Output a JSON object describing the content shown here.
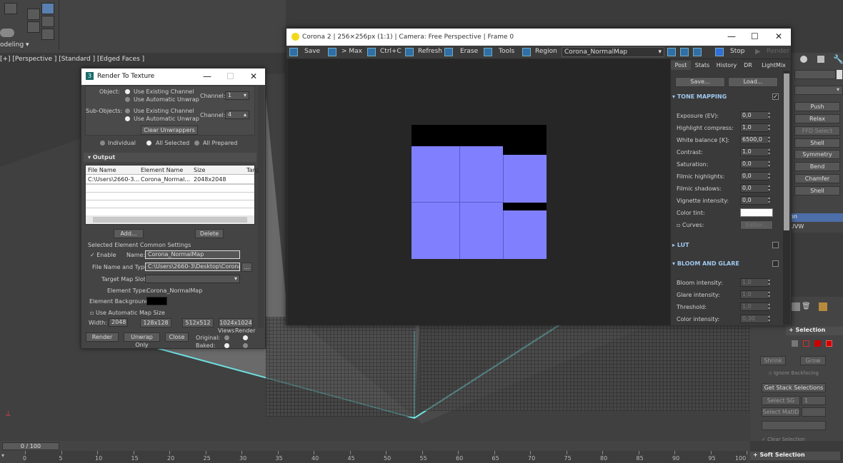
{
  "app": {
    "ribbon_mode": "odeling",
    "viewport_label": "[+] [Perspective ] [Standard ] [Edged Faces ]"
  },
  "render_to_texture": {
    "title": "Render To Texture",
    "object_label": "Object:",
    "object_opt1": "Use Existing Channel",
    "object_opt2": "Use Automatic Unwrap",
    "channel_label": "Channel:",
    "channel_value_1": "1",
    "subobjects_label": "Sub-Objects:",
    "sub_opt1": "Use Existing Channel",
    "sub_opt2": "Use Automatic Unwrap",
    "channel_value_2": "4",
    "clear_unwrappers": "Clear Unwrappers",
    "individual": "Individual",
    "all_selected": "All Selected",
    "all_prepared": "All Prepared",
    "output_header": "Output",
    "table_headers": [
      "File Name",
      "Element Name",
      "Size",
      "Targ"
    ],
    "table_row": [
      "C:\\Users\\2660-3...",
      "Corona_Normal...",
      "2048x2048",
      ""
    ],
    "add": "Add...",
    "delete": "Delete",
    "common_settings": "Selected Element Common Settings",
    "enable": "Enable",
    "name_label": "Name:",
    "name_value": "Corona_NormalMap",
    "file_label": "File Name and Type:",
    "file_value": "C:\\Users\\2660-3\\Desktop\\Corona_",
    "browse": "...",
    "target_slot": "Target Map Slot:",
    "element_type_label": "Element Type:",
    "element_type_value": "Corona_NormalMap",
    "element_bg": "Element Background:",
    "auto_map_size": "Use Automatic Map Size",
    "width_label": "Width:",
    "width_value": "2048",
    "size_128": "128x128",
    "size_512": "512x512",
    "size_1024": "1024x1024",
    "render": "Render",
    "unwrap_only": "Unwrap Only",
    "close": "Close",
    "views": "Views",
    "render_col": "Render",
    "original": "Original:",
    "baked": "Baked:"
  },
  "corona": {
    "title": "Corona 2 | 256×256px (1:1) | Camera: Free Perspective | Frame 0",
    "tools": {
      "save": "Save",
      "max": "> Max",
      "ctrlc": "Ctrl+C",
      "refresh": "Refresh",
      "erase": "Erase",
      "tools": "Tools",
      "region": "Region",
      "element": "Corona_NormalMap",
      "stop": "Stop",
      "render": "Render"
    },
    "tabs": [
      "Post",
      "Stats",
      "History",
      "DR",
      "LightMix"
    ],
    "save_btn": "Save...",
    "load_btn": "Load...",
    "tone_mapping": "TONE MAPPING",
    "params": [
      {
        "label": "Exposure (EV):",
        "value": "0,0"
      },
      {
        "label": "Highlight compress:",
        "value": "1,0"
      },
      {
        "label": "White balance [K]:",
        "value": "6500,0"
      },
      {
        "label": "Contrast:",
        "value": "1,0"
      },
      {
        "label": "Saturation:",
        "value": "0,0"
      },
      {
        "label": "Filmic highlights:",
        "value": "0,0"
      },
      {
        "label": "Filmic shadows:",
        "value": "0,0"
      },
      {
        "label": "Vignette intensity:",
        "value": "0,0"
      }
    ],
    "color_tint": "Color tint:",
    "curves": "Curves:",
    "editor": "Editor...",
    "lut": "LUT",
    "bloom_glare": "BLOOM AND GLARE",
    "bloom_params": [
      {
        "label": "Bloom intensity:",
        "value": "1,0"
      },
      {
        "label": "Glare intensity:",
        "value": "1,0"
      },
      {
        "label": "Threshold:",
        "value": "1,0"
      },
      {
        "label": "Color intensity:",
        "value": "0,30"
      }
    ]
  },
  "command_panel": {
    "modifiers": [
      "Push",
      "Relax",
      "FFD Select",
      "Shell",
      "Symmetry",
      "Bend",
      "Chamfer",
      "Shell"
    ],
    "stack_items": [
      "on",
      "UVW"
    ],
    "selection": "Selection",
    "shrink": "Shrink",
    "grow": "Grow",
    "ignore_backfacing": "Ignore Backfacing",
    "get_stack": "Get Stack Selections",
    "select_sg": "Select SG",
    "select_sg_value": "1",
    "select_matid": "Select MatID",
    "clear_selection": "Clear Selection",
    "soft_selection": "Soft Selection"
  },
  "timeline": {
    "frame": "0 / 100",
    "ticks": [
      "0",
      "5",
      "10",
      "15",
      "20",
      "25",
      "30",
      "35",
      "40",
      "45",
      "50",
      "55",
      "60",
      "65",
      "70",
      "75",
      "80",
      "85",
      "90",
      "95",
      "100"
    ]
  },
  "colors": {
    "normal_blue": "#8080ff",
    "accent_blue": "#2f6fa8",
    "selection_hl": "#4d6ea8"
  }
}
